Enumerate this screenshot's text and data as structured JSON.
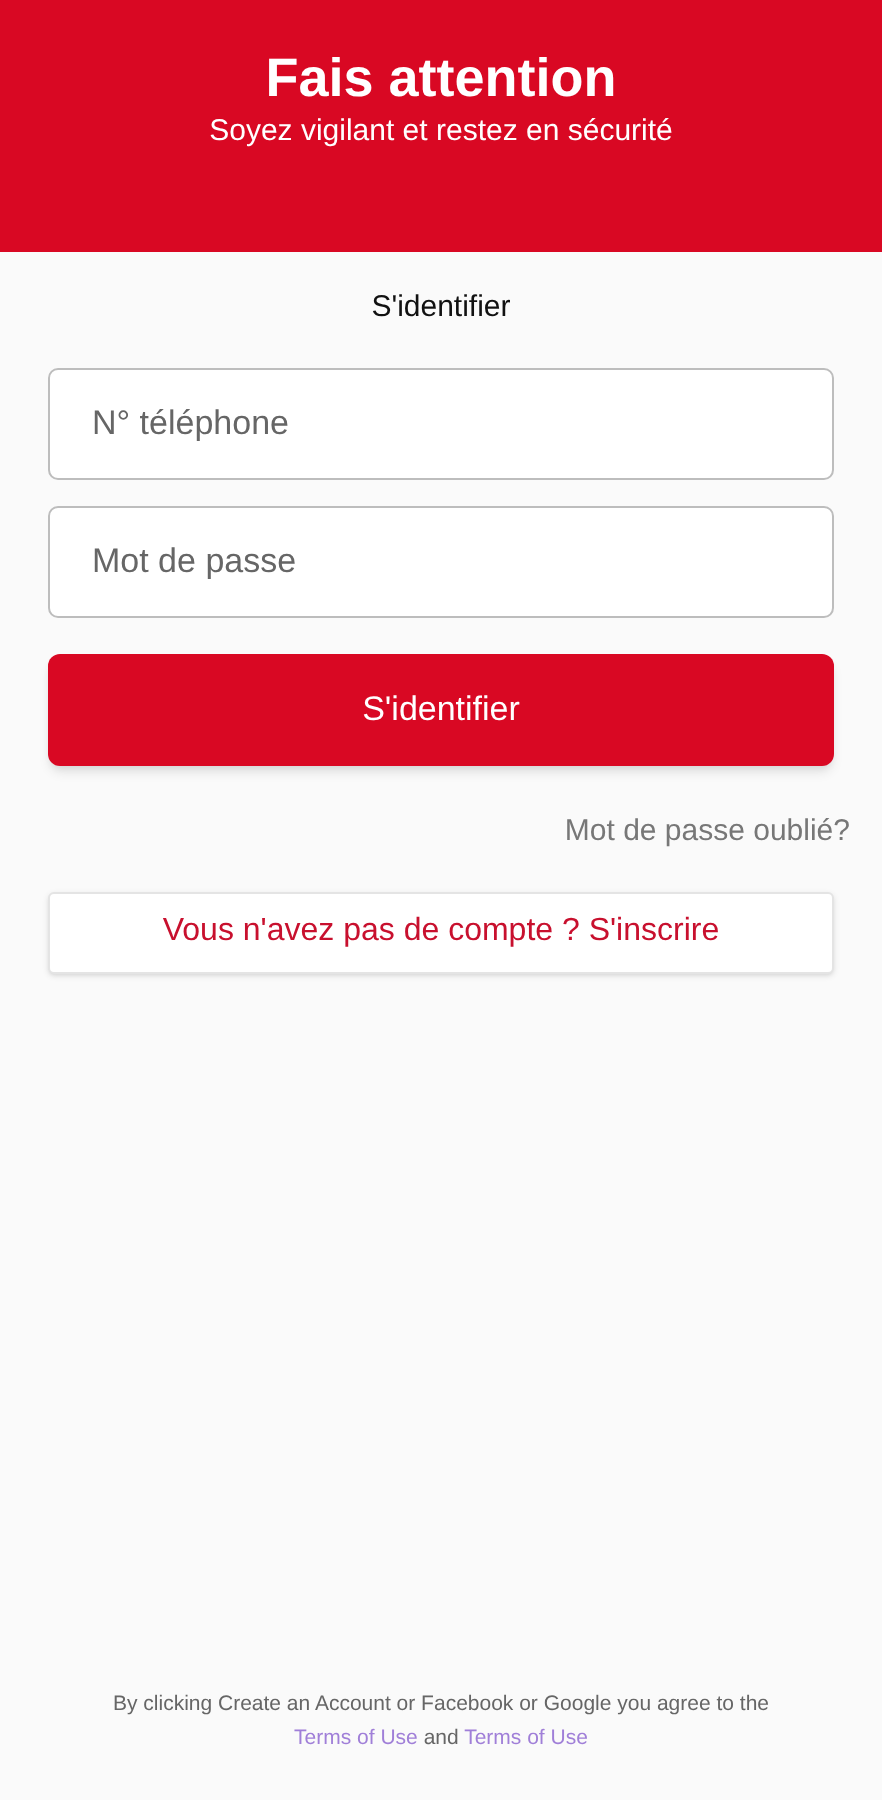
{
  "header": {
    "title": "Fais attention",
    "subtitle": "Soyez vigilant et restez en sécurité"
  },
  "heading": "S'identifier",
  "fields": [
    {
      "placeholder": "N° téléphone"
    },
    {
      "placeholder": "Mot de passe"
    }
  ],
  "submit": "S'identifier",
  "forgot": "Mot de passe oublié?",
  "signup": "Vous n'avez pas de compte ? S'inscrire",
  "footer": {
    "text": "By clicking Create an Account or Facebook or Google you agree to the",
    "link_1": "Terms of Use",
    "conjunction": "and",
    "link_2": "Terms of Use"
  }
}
